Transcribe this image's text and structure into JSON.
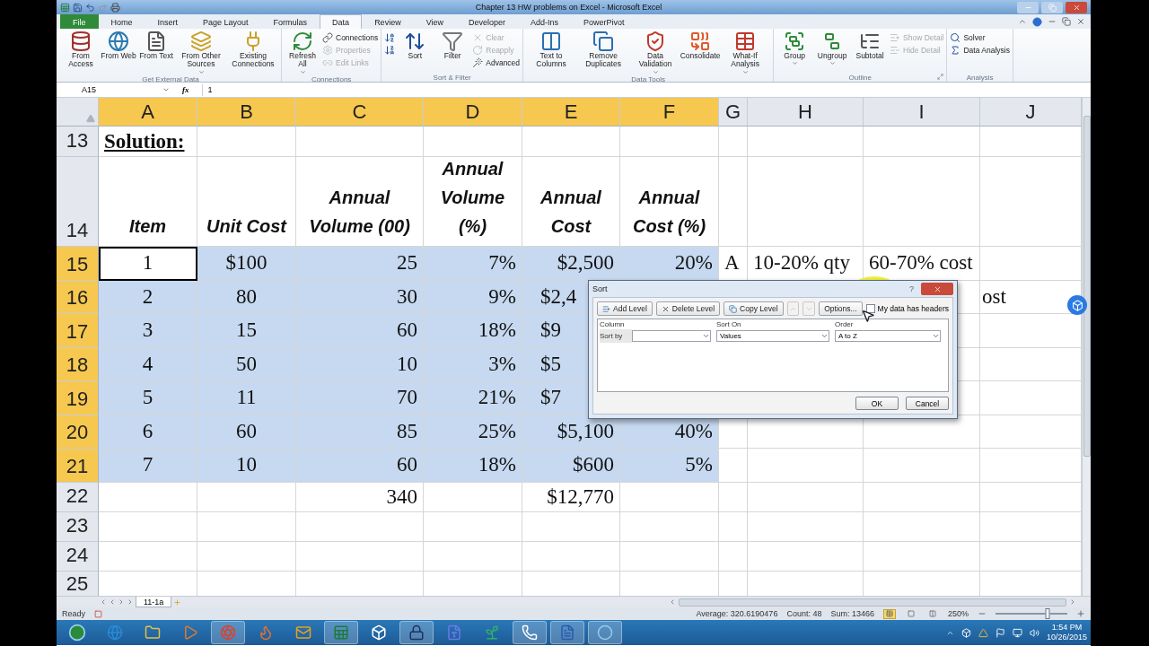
{
  "window": {
    "title": "Chapter 13 HW problems on Excel - Microsoft Excel"
  },
  "tabs": [
    {
      "label": "File",
      "kind": "file",
      "selected": false
    },
    {
      "label": "Home",
      "kind": "tab",
      "selected": false
    },
    {
      "label": "Insert",
      "kind": "tab",
      "selected": false
    },
    {
      "label": "Page Layout",
      "kind": "tab",
      "selected": false
    },
    {
      "label": "Formulas",
      "kind": "tab",
      "selected": false
    },
    {
      "label": "Data",
      "kind": "tab",
      "selected": true
    },
    {
      "label": "Review",
      "kind": "tab",
      "selected": false
    },
    {
      "label": "View",
      "kind": "tab",
      "selected": false
    },
    {
      "label": "Developer",
      "kind": "tab",
      "selected": false
    },
    {
      "label": "Add-Ins",
      "kind": "tab",
      "selected": false
    },
    {
      "label": "PowerPivot",
      "kind": "tab",
      "selected": false
    }
  ],
  "ribbon": {
    "groups": [
      {
        "label": "Get External Data",
        "launcher": false,
        "items": [
          {
            "kind": "large",
            "label": "From Access",
            "dropdown": false
          },
          {
            "kind": "large",
            "label": "From Web",
            "dropdown": false
          },
          {
            "kind": "large",
            "label": "From Text",
            "dropdown": false
          },
          {
            "kind": "large",
            "label": "From Other Sources",
            "dropdown": true
          },
          {
            "kind": "large",
            "label": "Existing Connections",
            "dropdown": false
          }
        ]
      },
      {
        "label": "Connections",
        "launcher": false,
        "items": [
          {
            "kind": "large",
            "label": "Refresh All",
            "dropdown": true
          },
          {
            "kind": "stack",
            "items": [
              {
                "label": "Connections",
                "disabled": false
              },
              {
                "label": "Properties",
                "disabled": true
              },
              {
                "label": "Edit Links",
                "disabled": true
              }
            ]
          }
        ]
      },
      {
        "label": "Sort & Filter",
        "launcher": false,
        "items": [
          {
            "kind": "stack",
            "items": [
              {
                "disabled": false
              },
              {
                "disabled": false
              }
            ]
          },
          {
            "kind": "large",
            "label": "Sort",
            "dropdown": false
          },
          {
            "kind": "large",
            "label": "Filter",
            "dropdown": false
          },
          {
            "kind": "stack",
            "items": [
              {
                "label": "Clear",
                "disabled": true
              },
              {
                "label": "Reapply",
                "disabled": true
              },
              {
                "label": "Advanced",
                "disabled": false
              }
            ]
          }
        ]
      },
      {
        "label": "Data Tools",
        "launcher": false,
        "items": [
          {
            "kind": "large",
            "label": "Text to Columns",
            "dropdown": false
          },
          {
            "kind": "large",
            "label": "Remove Duplicates",
            "dropdown": false
          },
          {
            "kind": "large",
            "label": "Data Validation",
            "dropdown": true
          },
          {
            "kind": "large",
            "label": "Consolidate",
            "dropdown": false
          },
          {
            "kind": "large",
            "label": "What-If Analysis",
            "dropdown": true
          }
        ]
      },
      {
        "label": "Outline",
        "launcher": true,
        "items": [
          {
            "kind": "large",
            "label": "Group",
            "dropdown": true
          },
          {
            "kind": "large",
            "label": "Ungroup",
            "dropdown": true
          },
          {
            "kind": "large",
            "label": "Subtotal",
            "dropdown": false
          },
          {
            "kind": "stack",
            "items": [
              {
                "label": "Show Detail",
                "disabled": true
              },
              {
                "label": "Hide Detail",
                "disabled": true
              }
            ]
          }
        ]
      },
      {
        "label": "Analysis",
        "launcher": false,
        "items": [
          {
            "kind": "stack",
            "items": [
              {
                "label": "Solver",
                "disabled": false
              },
              {
                "label": "Data Analysis",
                "disabled": false
              }
            ]
          }
        ]
      }
    ]
  },
  "formula_bar": {
    "name_box": "A15",
    "function_label": "fx",
    "value": "1"
  },
  "grid": {
    "columns": [
      {
        "label": "A",
        "selected": true
      },
      {
        "label": "B",
        "selected": true
      },
      {
        "label": "C",
        "selected": true
      },
      {
        "label": "D",
        "selected": true
      },
      {
        "label": "E",
        "selected": true
      },
      {
        "label": "F",
        "selected": true
      },
      {
        "label": "G",
        "selected": false
      },
      {
        "label": "H",
        "selected": false
      },
      {
        "label": "I",
        "selected": false
      },
      {
        "label": "J",
        "selected": false
      }
    ],
    "rows": [
      {
        "number": "13",
        "kind": "title",
        "selected": false,
        "cells": [
          "Solution:"
        ]
      },
      {
        "number": "14",
        "kind": "header",
        "selected": false,
        "cells": [
          "Item",
          "Unit Cost",
          "Annual Volume (00)",
          "Annual Volume (%)",
          "Annual Cost",
          "Annual Cost (%)"
        ]
      },
      {
        "number": "15",
        "kind": "data",
        "selected": true,
        "cells": [
          {
            "text": "1",
            "active": true
          },
          "$100",
          "25",
          "7%",
          "$2,500",
          "20%",
          "A",
          "10-20% qty",
          "60-70% cost"
        ]
      },
      {
        "number": "16",
        "kind": "data",
        "selected": true,
        "cells": [
          "2",
          "80",
          "30",
          "9%",
          {
            "text": "$2,4",
            "cut": true
          },
          null,
          null,
          null,
          null,
          {
            "text": "ost",
            "cut": true
          }
        ]
      },
      {
        "number": "17",
        "kind": "data",
        "selected": true,
        "cells": [
          "3",
          "15",
          "60",
          "18%",
          {
            "text": "$9",
            "cut": true
          }
        ]
      },
      {
        "number": "18",
        "kind": "data",
        "selected": true,
        "cells": [
          "4",
          "50",
          "10",
          "3%",
          {
            "text": "$5",
            "cut": true
          }
        ]
      },
      {
        "number": "19",
        "kind": "data",
        "selected": true,
        "cells": [
          "5",
          "11",
          "70",
          "21%",
          {
            "text": "$7",
            "cut": true
          }
        ]
      },
      {
        "number": "20",
        "kind": "data",
        "selected": true,
        "cells": [
          "6",
          "60",
          "85",
          "25%",
          "$5,100",
          "40%"
        ]
      },
      {
        "number": "21",
        "kind": "data",
        "selected": true,
        "cells": [
          "7",
          "10",
          "60",
          "18%",
          "$600",
          "5%"
        ]
      },
      {
        "number": "22",
        "kind": "total",
        "selected": false,
        "cells": [
          null,
          null,
          "340",
          null,
          "$12,770"
        ]
      },
      {
        "number": "23",
        "kind": "blank",
        "selected": false,
        "cells": []
      },
      {
        "number": "24",
        "kind": "blank",
        "selected": false,
        "cells": []
      },
      {
        "number": "25",
        "kind": "cut",
        "selected": false,
        "cells": []
      }
    ]
  },
  "sheet_tabs": [
    {
      "label": "11-1a",
      "selected": true
    }
  ],
  "status_bar": {
    "mode": "Ready",
    "average": "Average: 320.6190476",
    "count": "Count: 48",
    "sum": "Sum: 13466",
    "zoom": "250%",
    "zoom_slider": {
      "level": 0.72
    }
  },
  "dialog": {
    "title": "Sort",
    "help": "?",
    "tool_buttons": [
      {
        "label": "Add Level"
      },
      {
        "label": "Delete Level"
      },
      {
        "label": "Copy Level"
      }
    ],
    "move_buttons": [
      {
        "kind": "up",
        "disabled": true
      },
      {
        "kind": "down",
        "disabled": true
      }
    ],
    "options": "Options...",
    "headers_checkbox": {
      "label": "My data has headers",
      "checked": false
    },
    "columns": [
      "Column",
      "Sort On",
      "Order"
    ],
    "level": {
      "label": "Sort by",
      "sort_on": "Values",
      "order": "A to Z"
    },
    "ok": "OK",
    "cancel": "Cancel"
  },
  "taskbar": {
    "apps": [
      {
        "kind": "globe",
        "running": false
      },
      {
        "kind": "folder",
        "running": false
      },
      {
        "kind": "play",
        "running": false
      },
      {
        "kind": "wheel",
        "running": true
      },
      {
        "kind": "fox",
        "running": false
      },
      {
        "kind": "mail",
        "running": false
      },
      {
        "kind": "sheet",
        "running": true
      },
      {
        "kind": "box",
        "running": false
      },
      {
        "kind": "lock",
        "running": true
      },
      {
        "kind": "letter",
        "running": false
      },
      {
        "kind": "tree",
        "running": false
      },
      {
        "kind": "phone",
        "running": true
      },
      {
        "kind": "doc",
        "running": true
      },
      {
        "kind": "ring",
        "running": true
      }
    ],
    "time": "1:54 PM",
    "date": "10/26/2015"
  }
}
